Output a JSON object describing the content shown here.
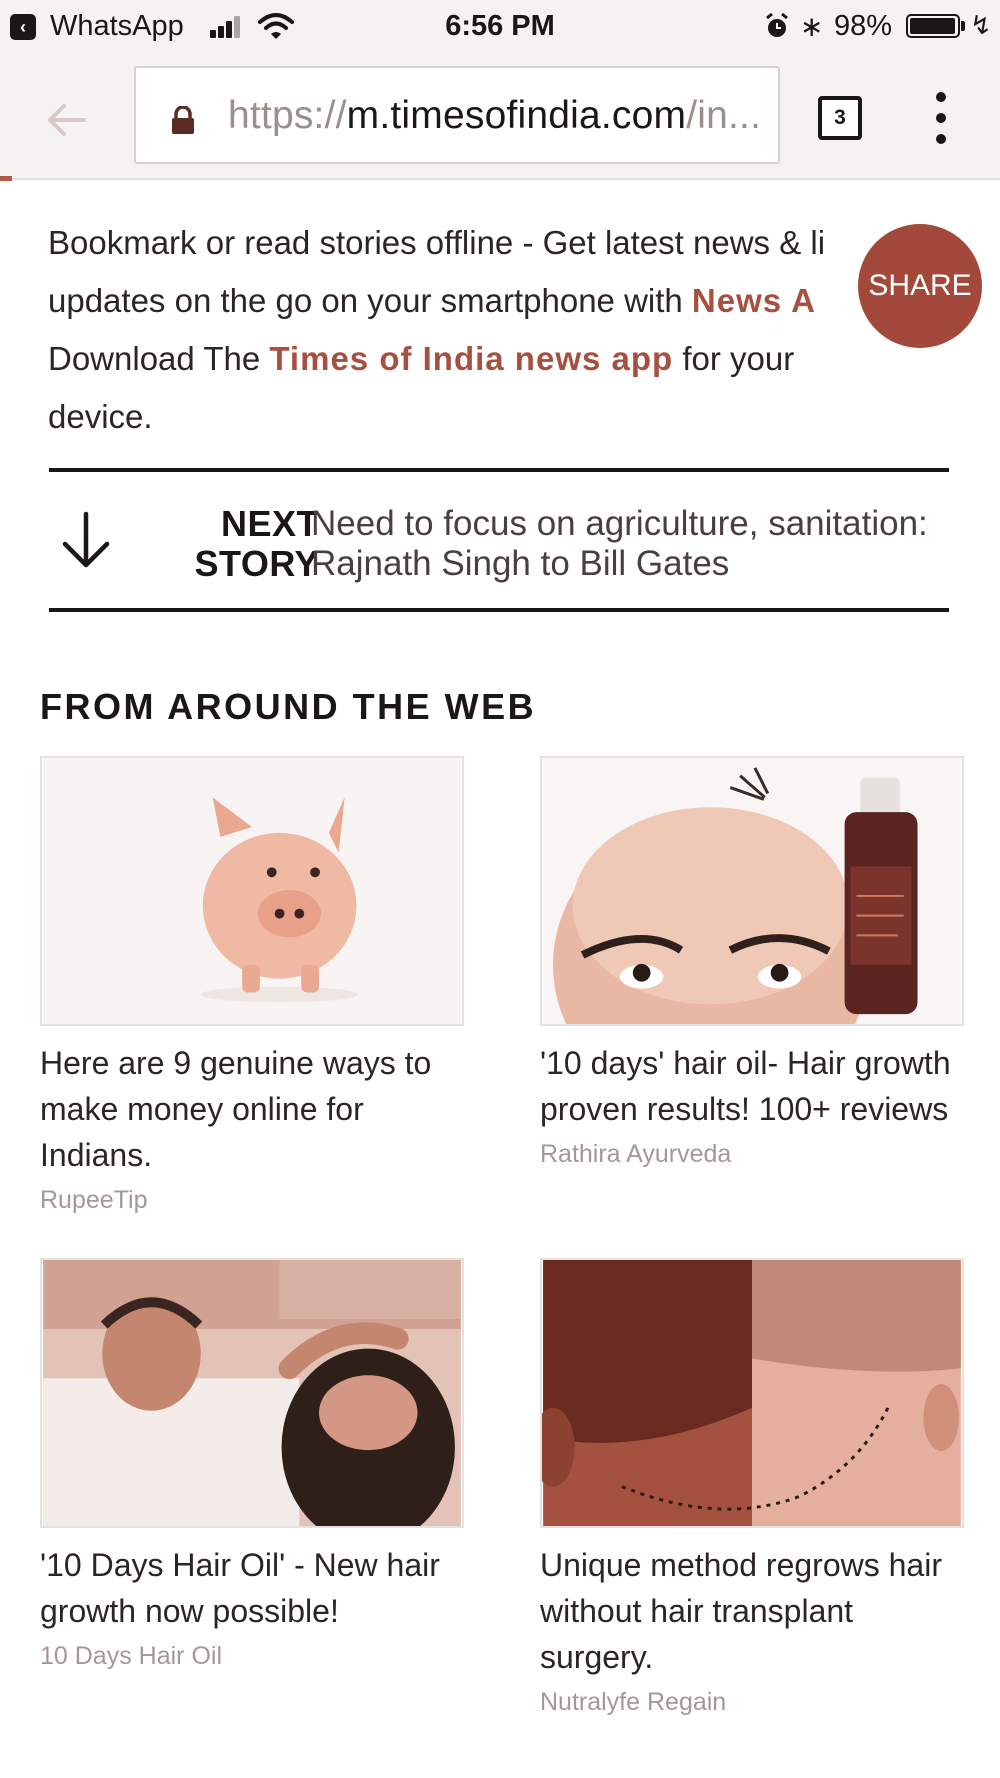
{
  "status_bar": {
    "back_app": "WhatsApp",
    "time": "6:56 PM",
    "battery": "98%",
    "battery_level": 0.98
  },
  "browser": {
    "url_scheme": "https://",
    "url_host": "m.timesofindia.com",
    "url_rest": "/in...",
    "tab_count": "3"
  },
  "article": {
    "promo_text_1": "Bookmark or read stories offline - Get latest news & li",
    "promo_text_2": "updates on the go on your smartphone with ",
    "promo_link_1": "News A",
    "promo_text_3": "Download The ",
    "promo_link_2": "Times of India news app",
    "promo_text_4": " for your",
    "promo_text_5": "device.",
    "share_label": "SHARE"
  },
  "next_story": {
    "label_line1": "NEXT",
    "label_line2": "STORY",
    "title": "Need to focus on agriculture, sanitation: Rajnath Singh to Bill Gates"
  },
  "web": {
    "heading": "FROM AROUND THE WEB",
    "cards": [
      {
        "title": "Here are 9 genuine ways to make money online for Indians.",
        "source": "RupeeTip"
      },
      {
        "title": "'10 days' hair oil- Hair growth proven results! 100+ reviews",
        "source": "Rathira Ayurveda"
      },
      {
        "title": "'10 Days Hair Oil' - New hair growth now possible!",
        "source": "10 Days Hair Oil"
      },
      {
        "title": "Unique method regrows hair without hair transplant surgery.",
        "source": "Nutralyfe Regain"
      }
    ]
  },
  "colors": {
    "accent": "#a65040",
    "share_bg": "#a3493b",
    "text": "#2b2523"
  }
}
